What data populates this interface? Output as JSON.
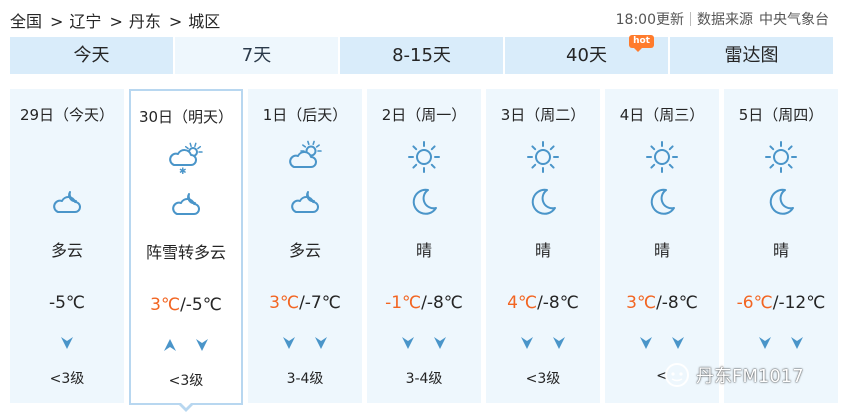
{
  "breadcrumb": {
    "items": [
      "全国",
      "辽宁",
      "丹东",
      "城区"
    ],
    "separator": ">"
  },
  "meta": {
    "update_time": "18:00更新",
    "source_label": "数据来源",
    "source_name": "中央气象台"
  },
  "tabs": [
    {
      "label": "今天",
      "active": false
    },
    {
      "label": "7天",
      "active": true
    },
    {
      "label": "8-15天",
      "active": false
    },
    {
      "label": "40天",
      "active": false,
      "badge": "hot"
    },
    {
      "label": "雷达图",
      "active": false
    }
  ],
  "days": [
    {
      "date": "29日（今天）",
      "day_icon": "none",
      "night_icon": "partly-cloudy-night-icon",
      "desc": "多云",
      "temp_high": "",
      "temp_sep": "",
      "temp_low": "-5℃",
      "wind_arrows": [
        "down"
      ],
      "wind": "<3级",
      "selected": false
    },
    {
      "date": "30日（明天）",
      "day_icon": "snow-shower-icon",
      "night_icon": "partly-cloudy-night-icon",
      "desc": "阵雪转多云",
      "temp_high": "3℃",
      "temp_sep": "/",
      "temp_low": "-5℃",
      "wind_arrows": [
        "up",
        "down"
      ],
      "wind": "<3级",
      "selected": true
    },
    {
      "date": "1日（后天）",
      "day_icon": "partly-cloudy-day-icon",
      "night_icon": "partly-cloudy-night-icon",
      "desc": "多云",
      "temp_high": "3℃",
      "temp_sep": "/",
      "temp_low": "-7℃",
      "wind_arrows": [
        "down",
        "down"
      ],
      "wind": "3-4级",
      "selected": false
    },
    {
      "date": "2日（周一）",
      "day_icon": "sun-icon",
      "night_icon": "moon-icon",
      "desc": "晴",
      "temp_high": "-1℃",
      "temp_sep": "/",
      "temp_low": "-8℃",
      "wind_arrows": [
        "down",
        "down"
      ],
      "wind": "3-4级",
      "selected": false
    },
    {
      "date": "3日（周二）",
      "day_icon": "sun-icon",
      "night_icon": "moon-icon",
      "desc": "晴",
      "temp_high": "4℃",
      "temp_sep": "/",
      "temp_low": "-8℃",
      "wind_arrows": [
        "down",
        "down"
      ],
      "wind": "<3级",
      "selected": false
    },
    {
      "date": "4日（周三）",
      "day_icon": "sun-icon",
      "night_icon": "moon-icon",
      "desc": "晴",
      "temp_high": "3℃",
      "temp_sep": "/",
      "temp_low": "-8℃",
      "wind_arrows": [
        "down",
        "down"
      ],
      "wind": "<",
      "selected": false
    },
    {
      "date": "5日（周四）",
      "day_icon": "sun-icon",
      "night_icon": "moon-icon",
      "desc": "晴",
      "temp_high": "-6℃",
      "temp_sep": "/",
      "temp_low": "-12℃",
      "wind_arrows": [
        "down",
        "down"
      ],
      "wind": "",
      "selected": false
    }
  ],
  "watermark": {
    "text": "丹东FM1017"
  },
  "colors": {
    "tab_bg": "#d9ecfa",
    "tab_active_bg": "#eef7fd",
    "card_bg": "#eef7fd",
    "icon_blue": "#4a95c9",
    "high_temp": "#f26522",
    "hot_badge": "#ff7b2c"
  }
}
